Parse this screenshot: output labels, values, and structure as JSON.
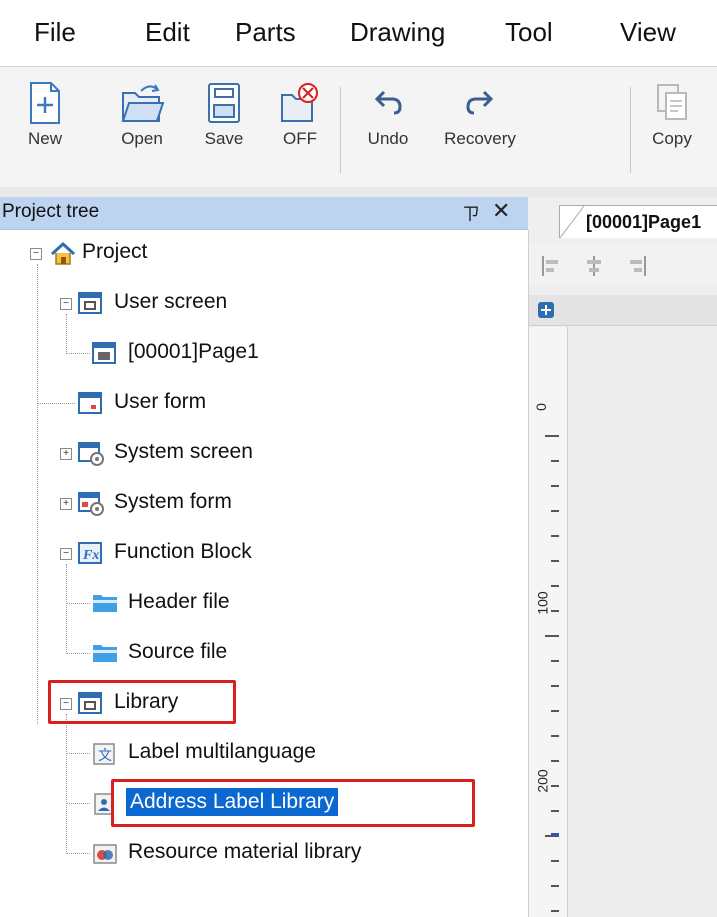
{
  "menu": [
    "File",
    "Edit",
    "Parts",
    "Drawing",
    "Tool",
    "View"
  ],
  "toolbar": {
    "new": "New",
    "open": "Open",
    "save": "Save",
    "off": "OFF",
    "undo": "Undo",
    "recovery": "Recovery",
    "copy": "Copy"
  },
  "tree": {
    "title": "Project tree",
    "pin": "ㄗ",
    "close": "✕",
    "nodes": {
      "project": "Project",
      "user_screen": "User screen",
      "page1": "[00001]Page1",
      "user_form": "User form",
      "system_screen": "System screen",
      "system_form": "System form",
      "function_block": "Function Block",
      "header_file": "Header file",
      "source_file": "Source file",
      "library": "Library",
      "label_multilanguage": "Label multilanguage",
      "address_label_library": "Address Label Library",
      "resource_material_library": "Resource material library"
    }
  },
  "editor": {
    "tab": "[00001]Page1",
    "ruler_marks": [
      "0",
      "100",
      "200"
    ]
  }
}
